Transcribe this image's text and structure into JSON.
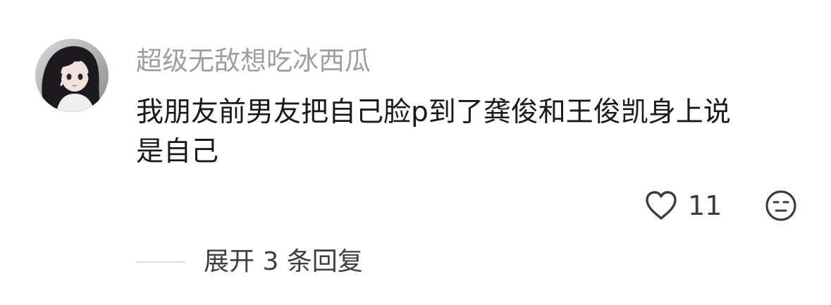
{
  "comment": {
    "username": "超级无敌想吃冰西瓜",
    "text_lines": [
      "我朋友前男友把自己脸p到了龚俊和王俊凯身上说",
      "是自己"
    ],
    "likes": "11",
    "avatar_icon": "avatar-anime-girl",
    "like_icon": "heart-icon",
    "reaction_icon": "neutral-face-icon"
  },
  "replies": {
    "expand_label": "展开 3 条回复"
  },
  "colors": {
    "username": "#9e9e9e",
    "text": "#1a1a1a",
    "icon": "#3c3c3c",
    "divider": "#dddddd"
  }
}
